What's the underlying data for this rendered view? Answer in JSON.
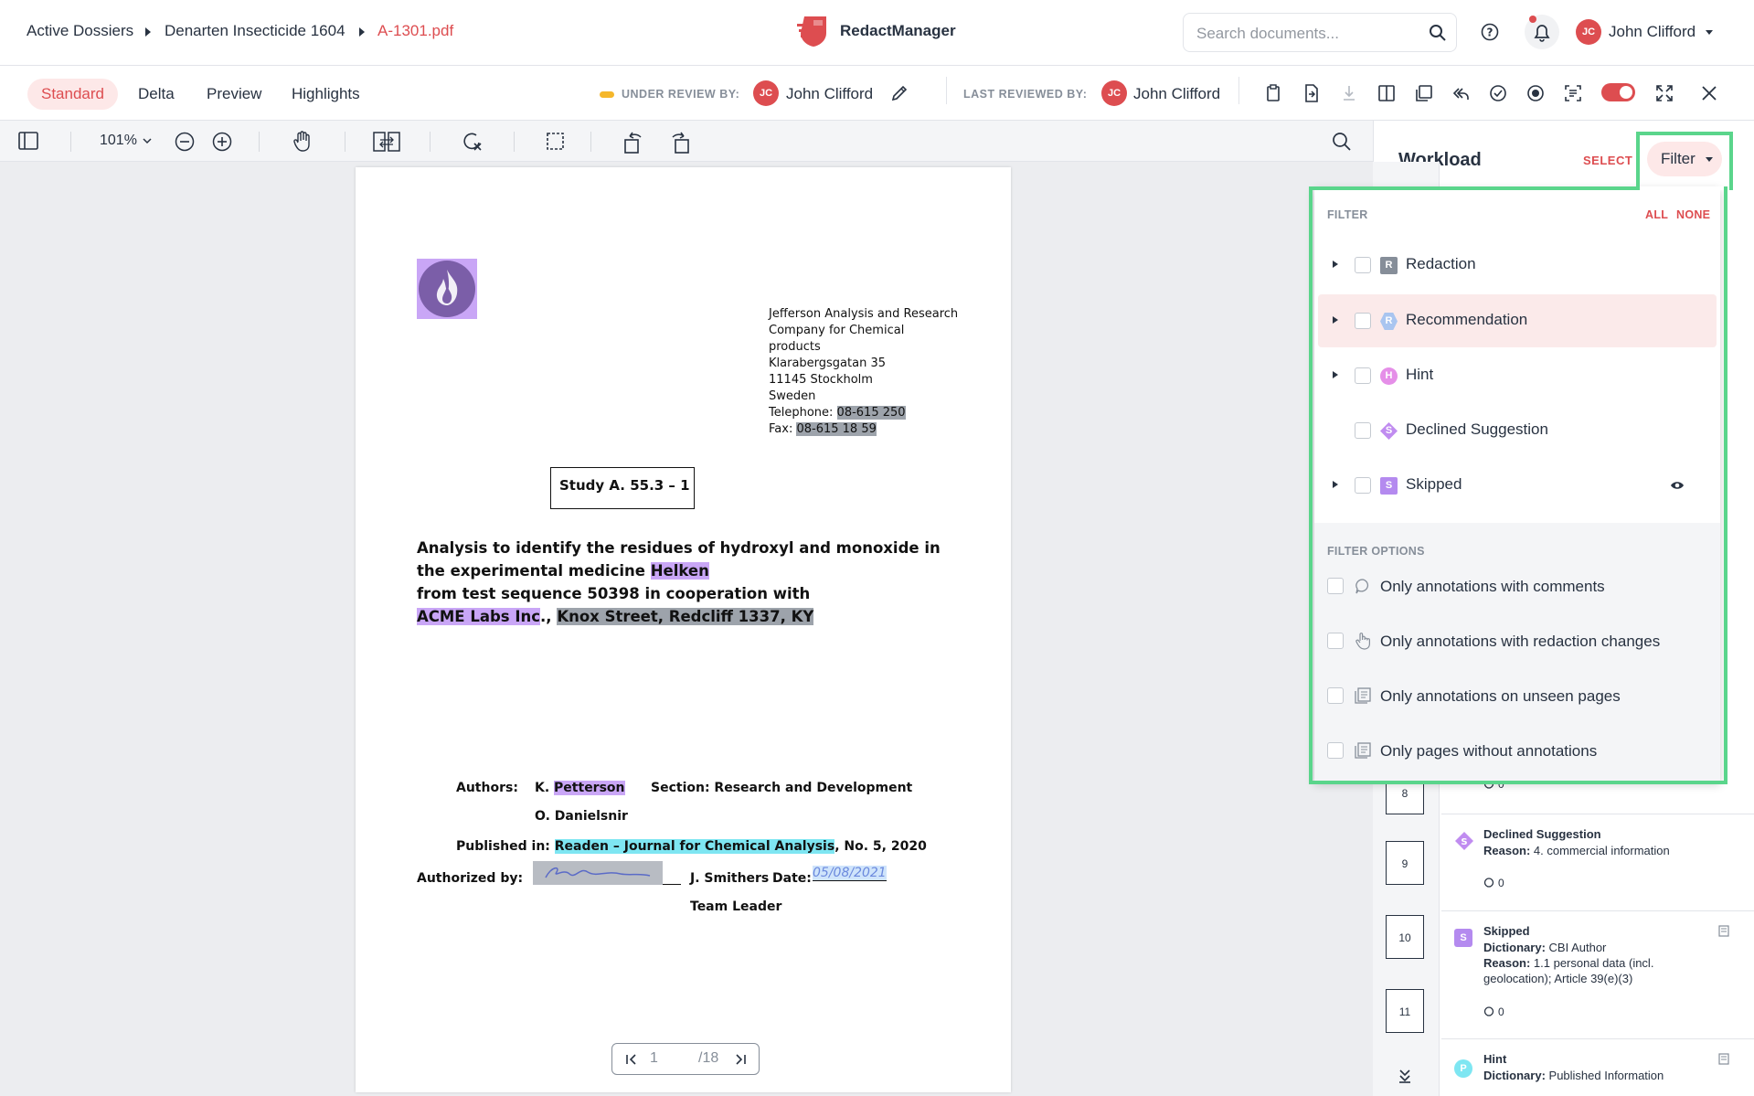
{
  "breadcrumb": {
    "items": [
      "Active Dossiers",
      "Denarten Insecticide 1604",
      "A-1301.pdf"
    ]
  },
  "app": {
    "name": "RedactManager"
  },
  "search": {
    "placeholder": "Search documents..."
  },
  "user": {
    "initials": "JC",
    "name": "John Clifford"
  },
  "view_tabs": [
    "Standard",
    "Delta",
    "Preview",
    "Highlights"
  ],
  "review": {
    "under_review_label": "UNDER REVIEW BY:",
    "under_review_user": "John Clifford",
    "last_reviewed_label": "LAST REVIEWED BY:",
    "last_reviewed_user": "John Clifford",
    "status_color": "#f5b72b"
  },
  "viewer": {
    "zoom": "101%",
    "page_current": "1",
    "page_total": "/18"
  },
  "document": {
    "company_lines": [
      "Jefferson Analysis and Research",
      "Company for Chemical",
      "products",
      "Klarabergsgatan 35",
      "11145 Stockholm",
      "Sweden"
    ],
    "telephone_label": "Telephone:",
    "telephone_value": "08-615 250",
    "fax_label": "Fax:",
    "fax_value": "08-615 18 59",
    "study": "Study A. 55.3 – 1",
    "title_line1": "Analysis to identify the residues of hydroxyl and monoxide in",
    "title_line2_pre": "the experimental medicine ",
    "title_line2_hl": "Helken",
    "title_line3": "from test sequence 50398 in cooperation with",
    "title_line4_hl1": "ACME Labs Inc",
    "title_line4_sep": ".,",
    "title_line4_hl2": "Knox Street, Redcliff 1337, KY",
    "authors_label": "Authors:",
    "author1_pre": "K. ",
    "author1_hl": "Petterson",
    "section": "Section: Research and Development",
    "author2": "O. Danielsnir",
    "published_label": "Published in:",
    "published_hl": "Readen – Journal for Chemical Analysis",
    "published_post": ", No. 5, 2020",
    "authorized_label": "Authorized by:",
    "signature": "J. Snider",
    "smithers": "J. Smithers",
    "date_label": "Date:",
    "date_value": "05/08/2021",
    "team_leader": "Team Leader"
  },
  "workload": {
    "title": "Workload",
    "select_label": "SELECT",
    "filter_label": "Filter"
  },
  "filter": {
    "heading": "FILTER",
    "all": "ALL",
    "none": "NONE",
    "types": [
      {
        "label": "Redaction",
        "badge": "R",
        "color": "#868e99"
      },
      {
        "label": "Recommendation",
        "badge": "R",
        "color": "#a9c5f0"
      },
      {
        "label": "Hint",
        "badge": "H",
        "color": "#e58fe8"
      },
      {
        "label": "Declined Suggestion",
        "badge": "S",
        "color": "#c08cf0"
      },
      {
        "label": "Skipped",
        "badge": "S",
        "color": "#b48aef"
      }
    ],
    "options_heading": "FILTER OPTIONS",
    "options": [
      "Only annotations with comments",
      "Only annotations with redaction changes",
      "Only annotations on unseen pages",
      "Only pages without annotations"
    ]
  },
  "thumbnails": [
    "8",
    "9",
    "10",
    "11"
  ],
  "annotations": [
    {
      "count": "0"
    },
    {
      "title": "Declined Suggestion",
      "reason_label": "Reason:",
      "reason": " 4. commercial information",
      "count": "0",
      "badge": "S"
    },
    {
      "title": "Skipped",
      "dict_label": "Dictionary:",
      "dict": " CBI Author",
      "reason_label": "Reason:",
      "reason": " 1.1 personal data (incl.",
      "reason2": "geolocation); Article 39(e)(3)",
      "count": "0",
      "badge": "S"
    },
    {
      "title": "Hint",
      "dict_label": "Dictionary:",
      "dict": " Published Information",
      "badge": "P"
    }
  ],
  "colors": {
    "accent": "#dd4d50",
    "highlight_green": "#5ad58b",
    "text": "#283241"
  }
}
